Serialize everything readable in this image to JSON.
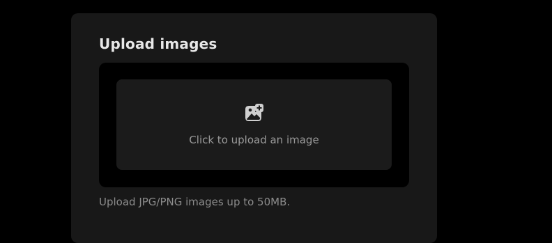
{
  "upload": {
    "title": "Upload images",
    "dropzone_label": "Click to upload an image",
    "hint": "Upload JPG/PNG images up to 50MB.",
    "icon": "image-add-icon"
  },
  "colors": {
    "page_background": "#000000",
    "panel_background": "#181818",
    "dropzone_background": "#1b1b1b",
    "title_text": "#e8e8e8",
    "muted_text": "#9a9a9a"
  }
}
